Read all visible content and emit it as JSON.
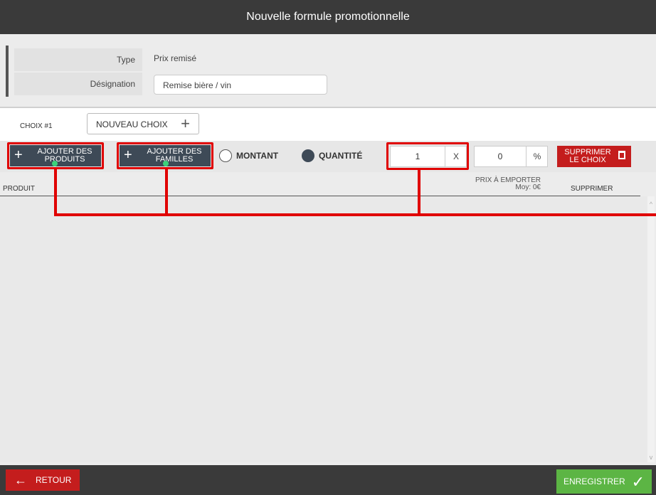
{
  "header": {
    "title": "Nouvelle formule promotionnelle"
  },
  "form": {
    "type_label": "Type",
    "type_value": "Prix remisé",
    "designation_label": "Désignation",
    "designation_value": "Remise bière / vin"
  },
  "choices": {
    "current_tab": "CHOIX #1",
    "new_choice_label": "NOUVEAU CHOIX",
    "new_choice_icon": "plus-icon"
  },
  "toolbar": {
    "add_products_label": "AJOUTER DES PRODUITS",
    "add_families_label": "AJOUTER DES FAMILLES",
    "mode_amount_label": "MONTANT",
    "mode_quantity_label": "QUANTITÉ",
    "selected_mode": "QUANTITÉ",
    "quantity_value": "1",
    "quantity_suffix": "X",
    "percent_value": "0",
    "percent_suffix": "%",
    "delete_choice_label": "SUPPRIMER LE CHOIX",
    "delete_icon": "trash-icon"
  },
  "table": {
    "col_product": "PRODUIT",
    "col_price_line1": "PRIX À EMPORTER",
    "col_price_line2": "Moy: 0€",
    "col_delete": "SUPPRIMER",
    "rows": []
  },
  "footer": {
    "back_label": "RETOUR",
    "back_icon": "arrow-left-icon",
    "save_label": "ENREGISTRER",
    "save_icon": "check-icon"
  },
  "colors": {
    "annotation_red": "#e00000",
    "danger_red": "#c41d1d",
    "success_green": "#5cb544",
    "dark_button": "#3e4a57",
    "topbar": "#3a3a3a"
  }
}
